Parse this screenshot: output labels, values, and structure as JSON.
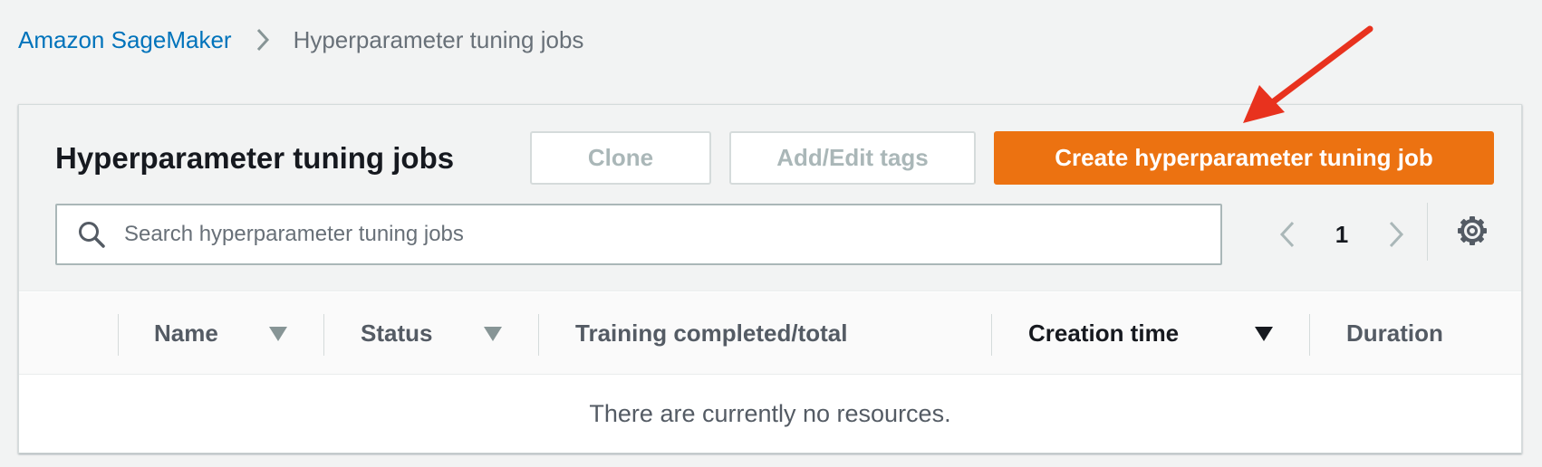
{
  "breadcrumb": {
    "root": "Amazon SageMaker",
    "current": "Hyperparameter tuning jobs"
  },
  "panel": {
    "title": "Hyperparameter tuning jobs",
    "buttons": {
      "clone": "Clone",
      "tags": "Add/Edit tags",
      "create": "Create hyperparameter tuning job"
    },
    "search": {
      "placeholder": "Search hyperparameter tuning jobs",
      "value": ""
    },
    "pagination": {
      "page": "1"
    }
  },
  "table": {
    "columns": [
      {
        "label": "Name",
        "sortable": true,
        "sorted": false
      },
      {
        "label": "Status",
        "sortable": true,
        "sorted": false
      },
      {
        "label": "Training completed/total",
        "sortable": false
      },
      {
        "label": "Creation time",
        "sortable": true,
        "sorted": true
      },
      {
        "label": "Duration",
        "sortable": false
      }
    ],
    "empty_message": "There are currently no resources."
  },
  "colors": {
    "primary": "#ec7211",
    "link": "#0073bb",
    "annotation_arrow": "#e8321e"
  },
  "icons": {
    "breadcrumb_separator": "chevron-right-icon",
    "search": "search-icon",
    "prev": "chevron-left-icon",
    "next": "chevron-right-icon",
    "settings": "gear-icon",
    "sort": "caret-down-icon",
    "annotation": "red-arrow-annotation"
  }
}
